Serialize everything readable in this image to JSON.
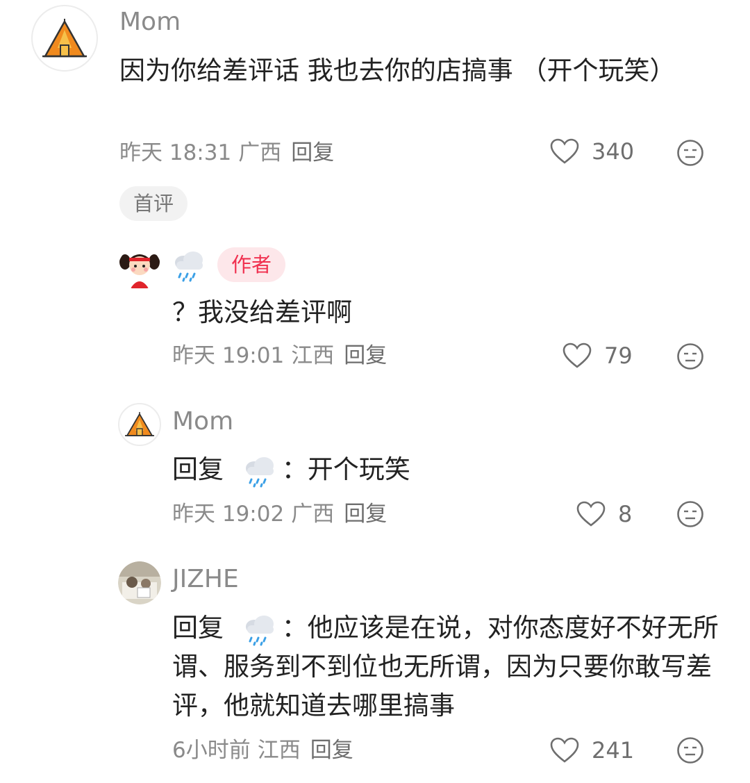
{
  "comments": [
    {
      "name": "Mom",
      "avatar": "tent-icon",
      "text": "因为你给差评话 我也去你的店搞事 （开个玩笑）",
      "time": "昨天 18:31",
      "location": "广西",
      "reply_label": "回复",
      "likes": "340",
      "badge": "首评"
    },
    {
      "avatar": "girl-avatar",
      "name_icon": "rain-cloud-emoji",
      "author_badge": "作者",
      "text": "？我没给差评啊",
      "time": "昨天 19:01",
      "location": "江西",
      "reply_label": "回复",
      "likes": "79"
    },
    {
      "name": "Mom",
      "avatar": "tent-icon",
      "reply_prefix": "回复",
      "text": "：开个玩笑",
      "time": "昨天 19:02",
      "location": "广西",
      "reply_label": "回复",
      "likes": "8"
    },
    {
      "name": "JIZHE",
      "avatar": "photo-avatar",
      "reply_prefix": "回复",
      "text": "：他应该是在说，对你态度好不好无所谓、服务到不到位也无所谓，因为只要你敢写差评，他就知道去哪里搞事",
      "time": "6小时前",
      "location": "江西",
      "reply_label": "回复",
      "likes": "241"
    }
  ],
  "colors": {
    "author_badge_bg": "#fde7ea",
    "author_badge_text": "#f0304f",
    "first_badge_bg": "#f2f2f2",
    "meta_text": "#8a8a8a",
    "tent_orange": "#f08a1e"
  }
}
